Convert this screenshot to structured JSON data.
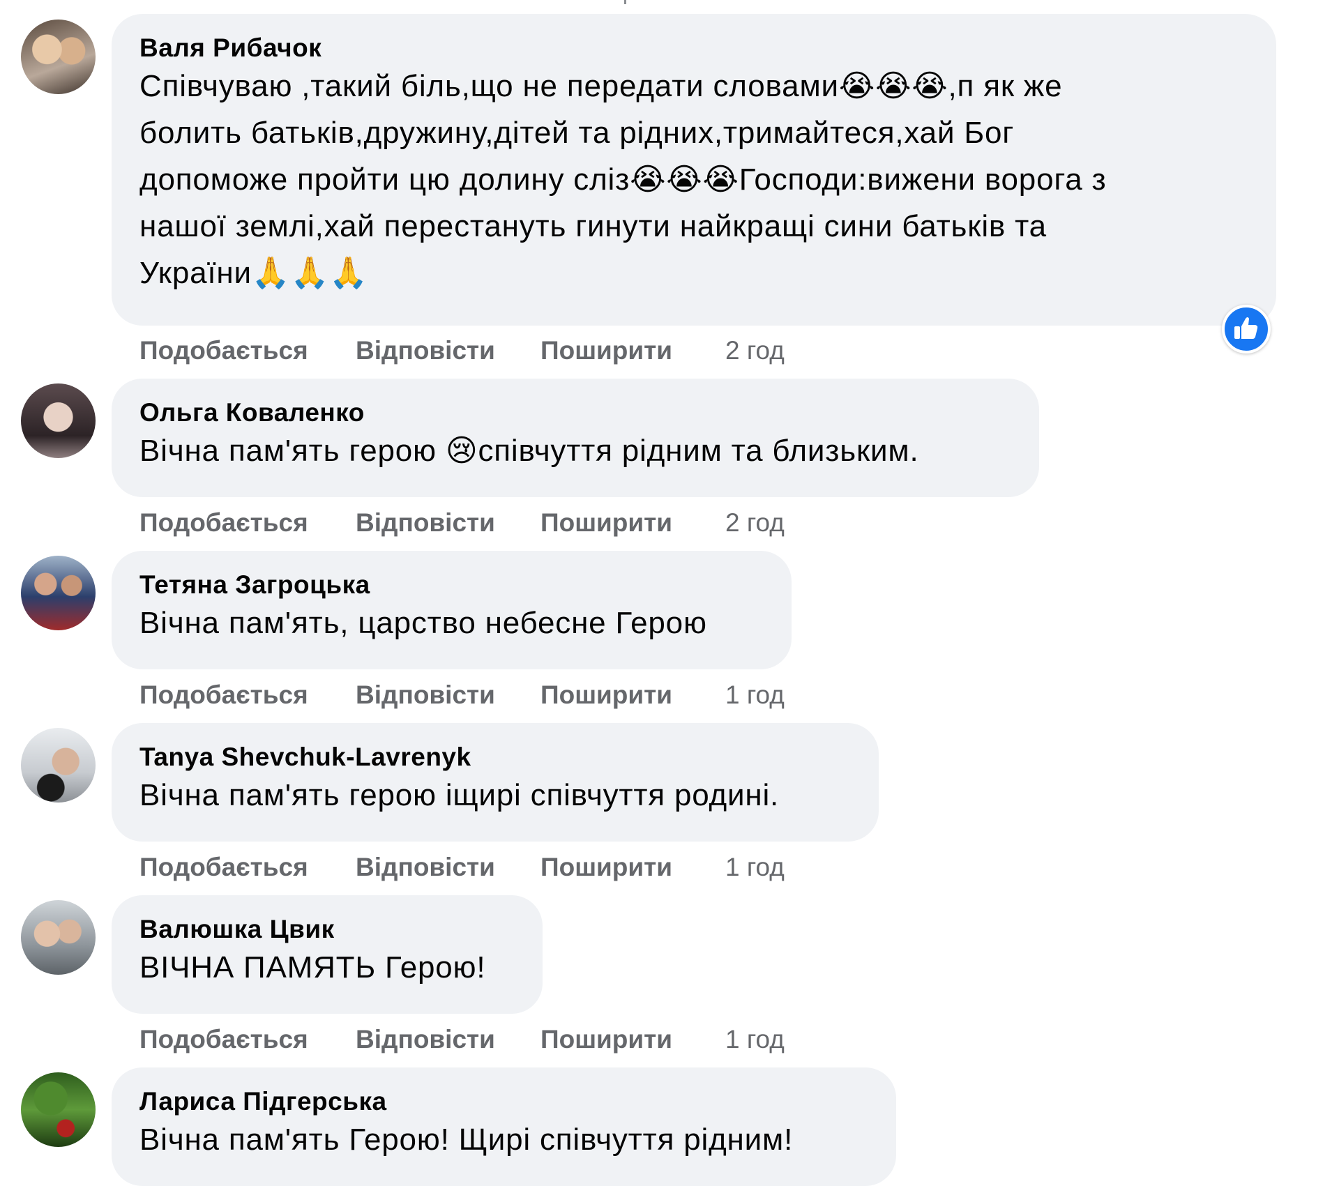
{
  "actions": {
    "like": "Подобається",
    "reply": "Відповісти",
    "share": "Поширити"
  },
  "comments": [
    {
      "author": "Валя Рибачок",
      "text": "Співчуваю ,такий біль,що не передати словами😭😭😭,п як же\nболить батьків,дружину,дітей та рідних,тримайтеся,хай Бог\nдопоможе пройти цю долину сліз😭😭😭Господи:вижени ворога з\nнашої землі,хай перестануть гинути найкращі сини батьків та\nУкраїни🙏🙏🙏",
      "time": "2 год",
      "reaction": "like-icon"
    },
    {
      "author": "Ольга Коваленко",
      "text": "Вічна пам'ять герою 😢співчуття рідним та близьким.",
      "time": "2 год"
    },
    {
      "author": "Тетяна Загроцька",
      "text": "Вічна пам'ять, царство небесне Герою",
      "time": "1 год"
    },
    {
      "author": "Tanya Shevchuk-Lavrenyk",
      "text": "Вічна пам'ять герою іщирі співчуття родині.",
      "time": "1 год"
    },
    {
      "author": "Валюшка Цвик",
      "text": "ВІЧНА ПАМЯТЬ Герою!",
      "time": "1 год"
    },
    {
      "author": "Лариса Підгерська",
      "text": "Вічна пам'ять Герою! Щирі співчуття рідним!"
    }
  ],
  "colors": {
    "bubble": "#f0f2f5",
    "secondary_text": "#65676b",
    "like_blue": "#1877f2"
  }
}
